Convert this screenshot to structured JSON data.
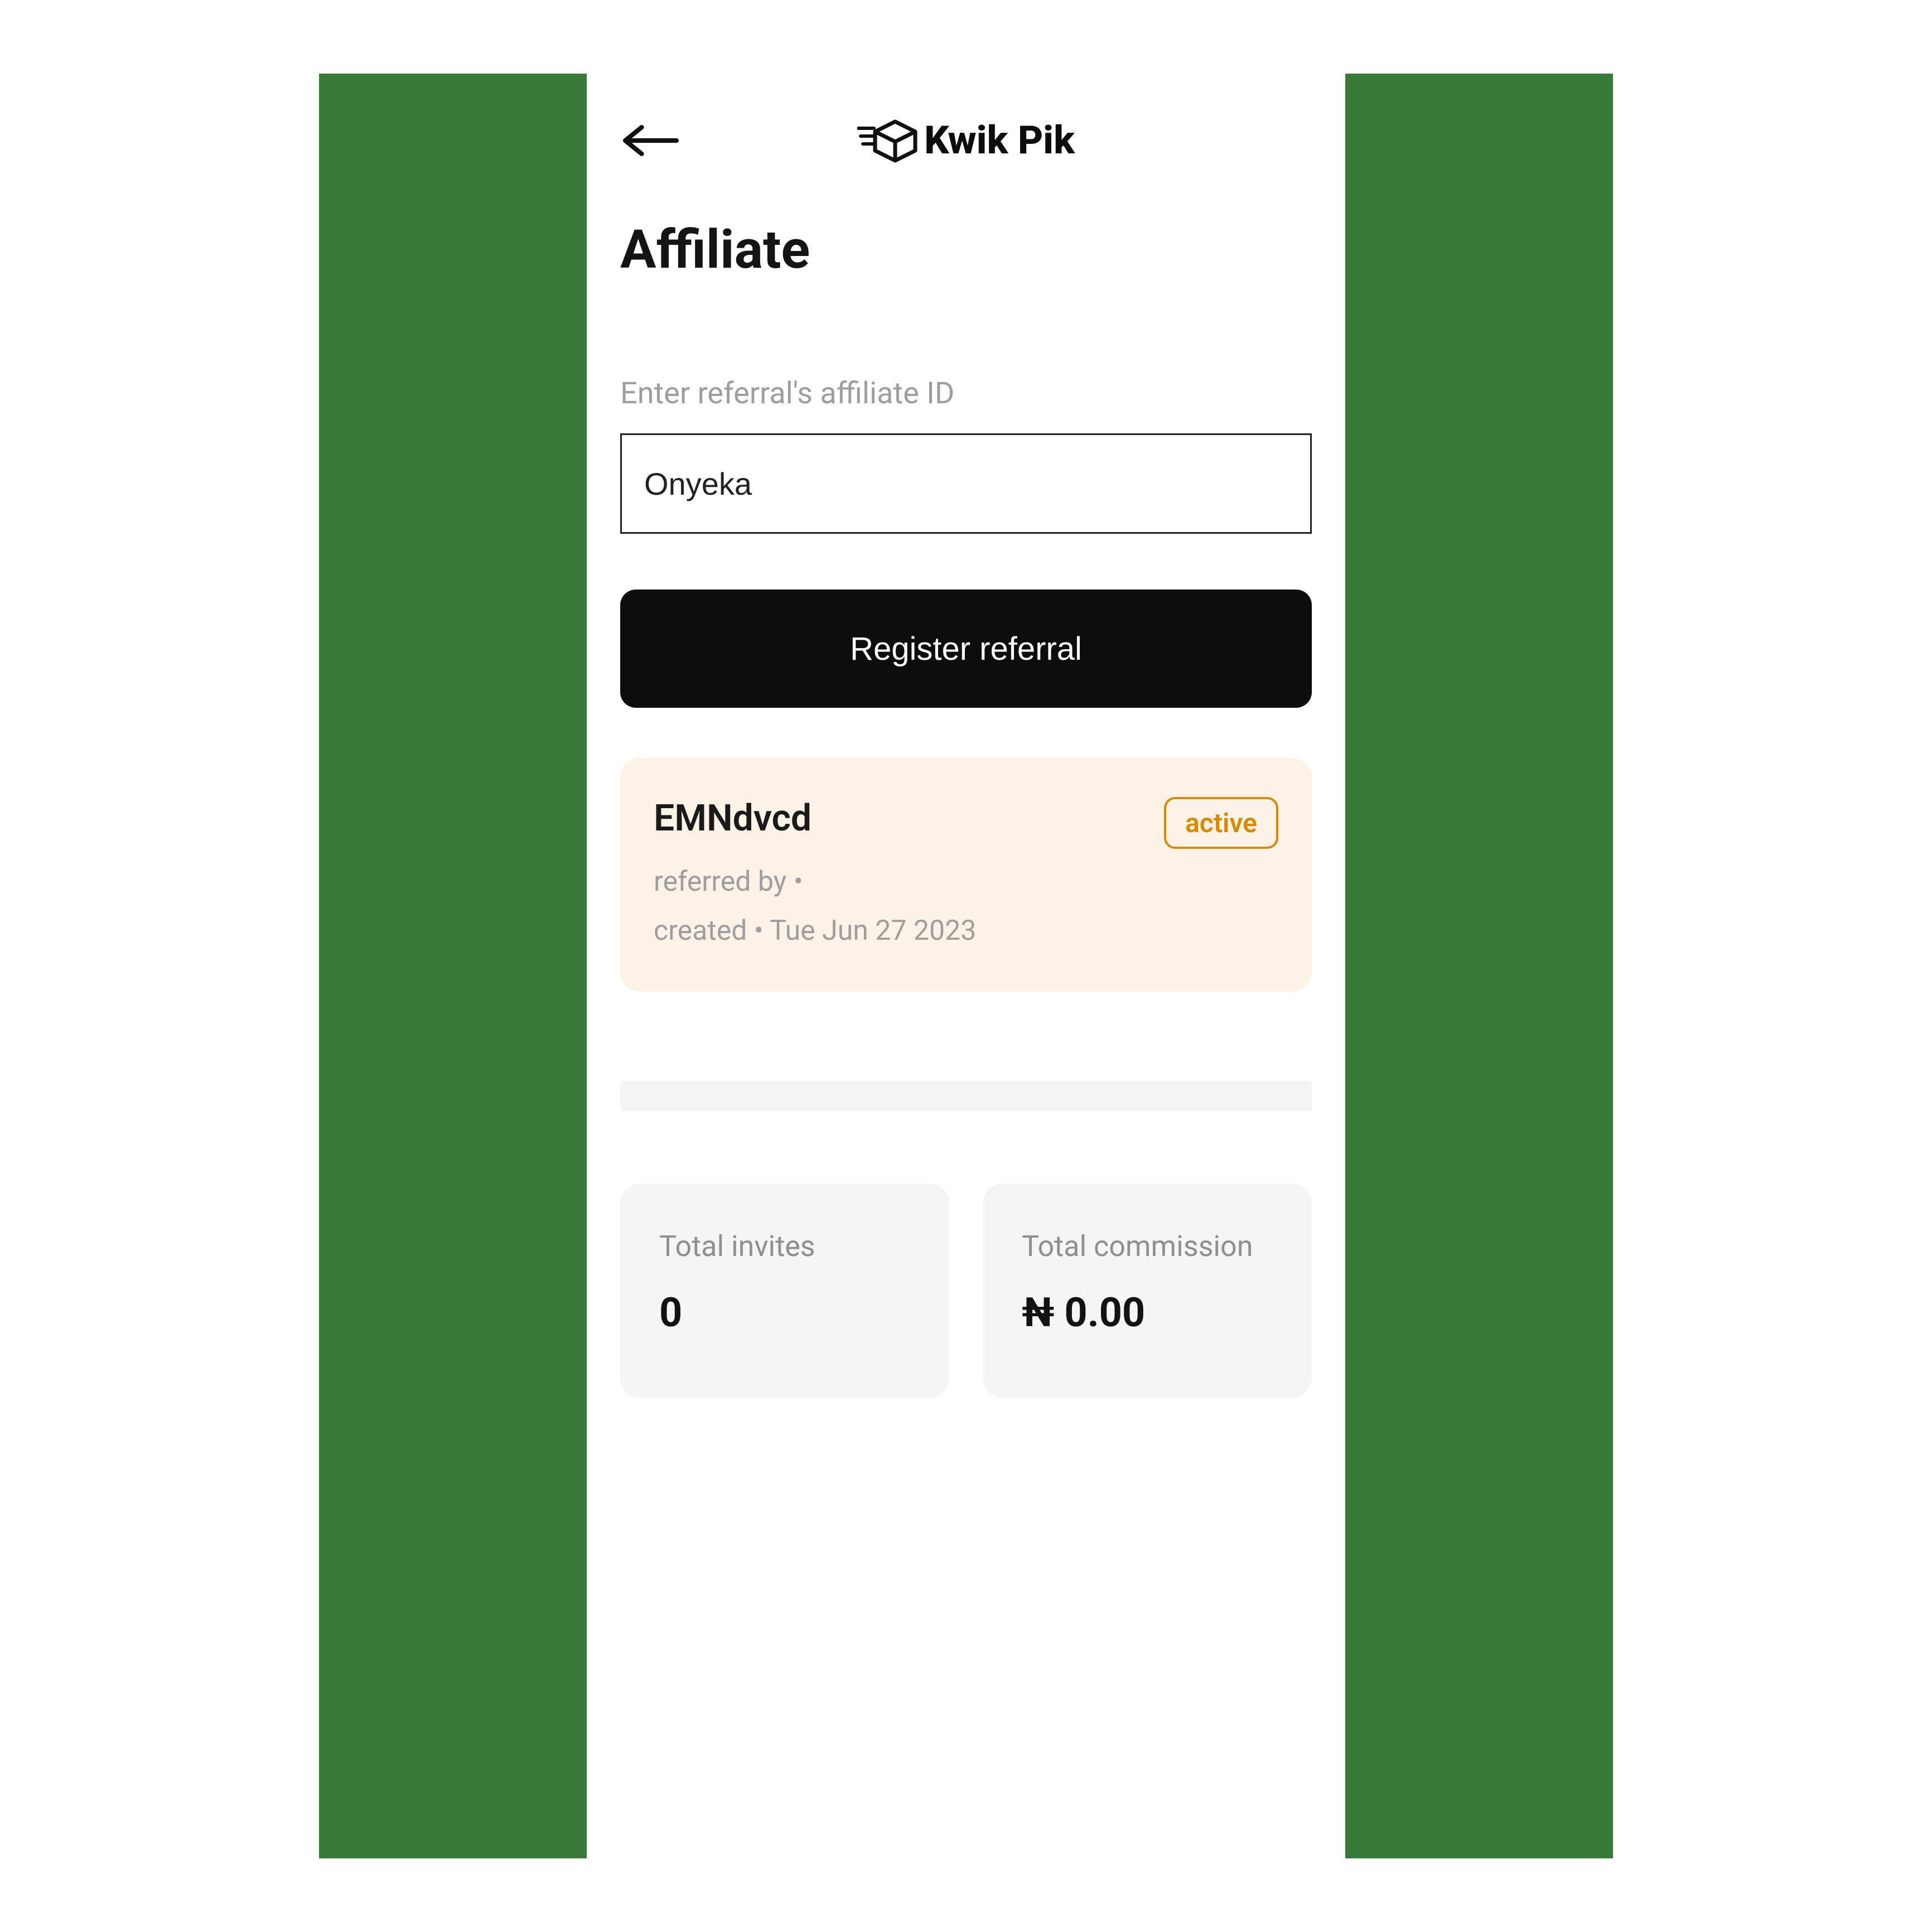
{
  "header": {
    "brand": "Kwik Pik"
  },
  "page": {
    "title": "Affiliate"
  },
  "form": {
    "label": "Enter referral's affiliate ID",
    "input_value": "Onyeka",
    "submit_label": "Register referral"
  },
  "referral_card": {
    "code": "EMNdvcd",
    "status": "active",
    "referred_by_line": "referred by  •",
    "created_line": "created  •  Tue Jun 27 2023"
  },
  "stats": {
    "invites": {
      "label": "Total invites",
      "value": "0"
    },
    "commission": {
      "label": "Total commission",
      "value": "₦ 0.00"
    }
  }
}
